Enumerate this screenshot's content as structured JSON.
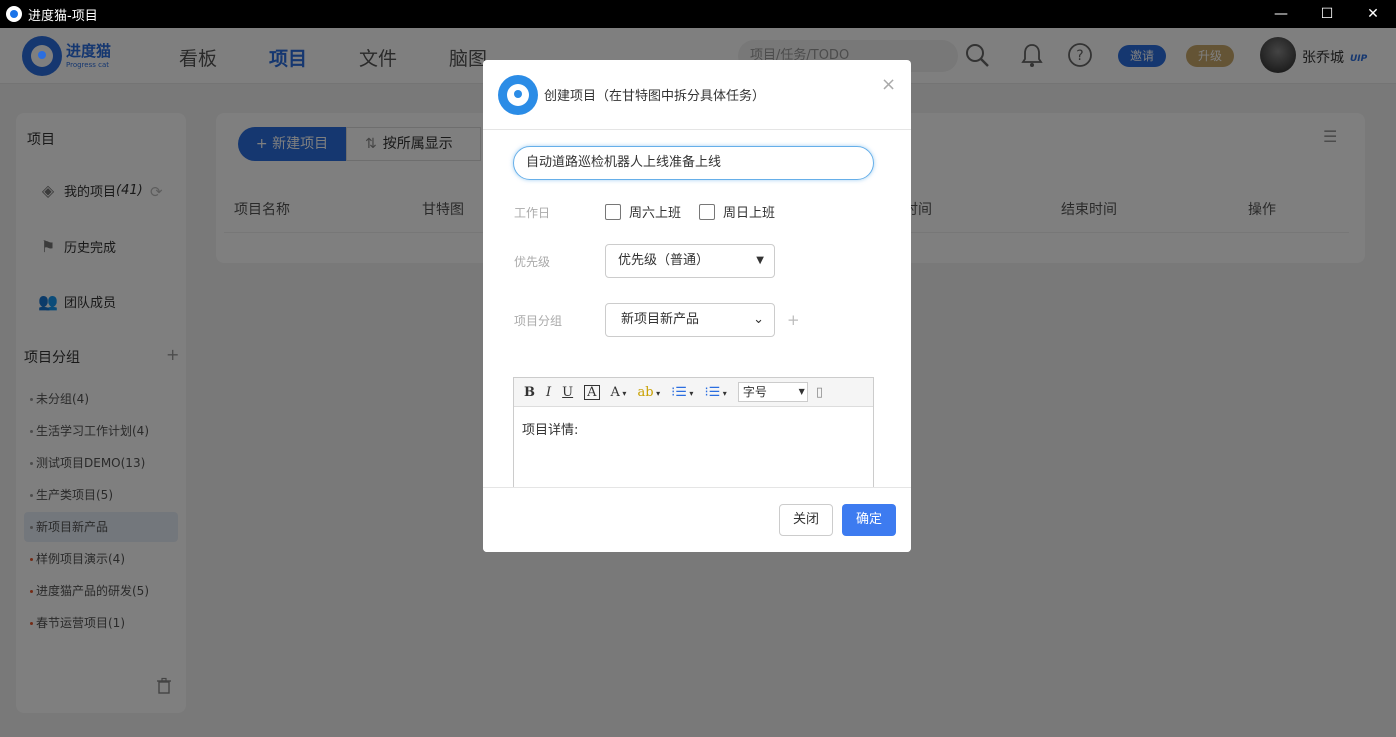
{
  "window": {
    "title": "进度猫-项目",
    "min": "—",
    "max": "☐",
    "close": "✕"
  },
  "logo": {
    "cn": "进度猫",
    "en": "Progress cat"
  },
  "nav": {
    "board": "看板",
    "project": "项目",
    "file": "文件",
    "mindmap": "脑图"
  },
  "search": {
    "placeholder": "项目/任务/TODO"
  },
  "header": {
    "invite": "邀请",
    "upgrade": "升级",
    "username": "张乔城",
    "vip": "UIP",
    "invite_color": "#2b6ee0",
    "upgrade_color": "#c9a86a"
  },
  "sidebar": {
    "title": "项目",
    "my_projects": "我的项目",
    "my_projects_count": "(41)",
    "history": "历史完成",
    "team": "团队成员",
    "group_title": "项目分组",
    "groups": [
      {
        "label": "未分组(4)"
      },
      {
        "label": "生活学习工作计划(4)"
      },
      {
        "label": "测试项目DEMO(13)"
      },
      {
        "label": "生产类项目(5)"
      },
      {
        "label": "新项目新产品"
      },
      {
        "label": "样例项目演示(4)"
      },
      {
        "label": "进度猫产品的研发(5)"
      },
      {
        "label": "春节运营项目(1)"
      }
    ]
  },
  "main": {
    "new_project": "+ 新建项目",
    "sort_label": "按所属显示",
    "columns": {
      "name": "项目名称",
      "gantt": "甘特图",
      "start_suffix": "时间",
      "end": "结束时间",
      "action": "操作"
    }
  },
  "modal": {
    "title": "创建项目（在甘特图中拆分具体任务）",
    "close": "×",
    "name_value": "自动道路巡检机器人上线准备上线",
    "workday_label": "工作日",
    "saturday": "周六上班",
    "sunday": "周日上班",
    "priority_label": "优先级",
    "priority_value": "优先级（普通）",
    "group_label": "项目分组",
    "group_value": "新项目新产品",
    "editor": {
      "bold": "B",
      "italic": "I",
      "underline": "U",
      "font_a": "A",
      "font_color": "A",
      "fontsize": "字号",
      "body": "项目详情:"
    },
    "btn_close": "关闭",
    "btn_ok": "确定"
  }
}
